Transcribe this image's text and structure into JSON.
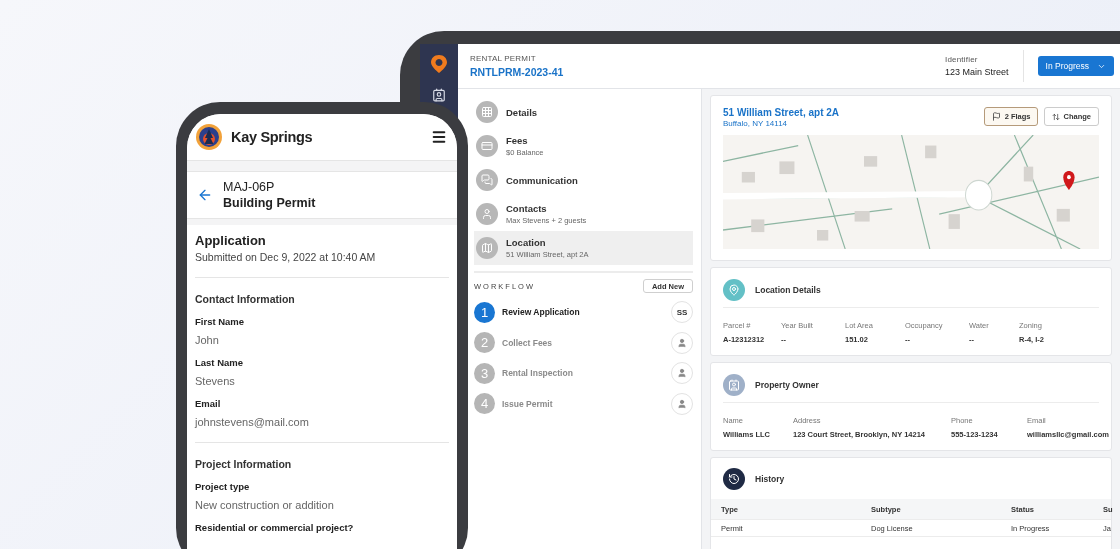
{
  "phone": {
    "brand": "Kay Springs",
    "record": {
      "id": "MAJ-06P",
      "title": "Building Permit"
    },
    "application": {
      "title": "Application",
      "submitted": "Submitted on Dec 9, 2022 at 10:40 AM"
    },
    "sections": [
      {
        "title": "Contact Information",
        "fields": [
          {
            "label": "First Name",
            "value": "John"
          },
          {
            "label": "Last Name",
            "value": "Stevens"
          },
          {
            "label": "Email",
            "value": "johnstevens@mail.com"
          }
        ]
      },
      {
        "title": "Project Information",
        "fields": [
          {
            "label": "Project type",
            "value": "New construction or addition"
          },
          {
            "label": "Residential or commercial project?"
          }
        ]
      }
    ]
  },
  "tablet": {
    "header": {
      "type": "RENTAL PERMIT",
      "number": "RNTLPRM-2023-41",
      "identifier_label": "Identifier",
      "identifier": "123 Main Street",
      "status": "In Progress"
    },
    "nav": [
      {
        "kind": "details",
        "label": "Details",
        "selected": false
      },
      {
        "kind": "fees",
        "label": "Fees",
        "sub": "$0 Balance",
        "selected": false
      },
      {
        "kind": "communication",
        "label": "Communication",
        "selected": false
      },
      {
        "kind": "contacts",
        "label": "Contacts",
        "sub": "Max Stevens + 2 guests",
        "selected": false
      },
      {
        "kind": "location",
        "label": "Location",
        "sub": "51 William Street, apt 2A",
        "selected": true
      }
    ],
    "workflow": {
      "title": "WORKFLOW",
      "add": "Add New",
      "steps": [
        {
          "number": "1",
          "label": "Review Application",
          "active": true,
          "assignee": "SS"
        },
        {
          "number": "2",
          "label": "Collect Fees",
          "active": false
        },
        {
          "number": "3",
          "label": "Rental Inspection",
          "active": false
        },
        {
          "number": "4",
          "label": "Issue Permit",
          "active": false
        }
      ]
    },
    "address": {
      "street": "51 William Street, apt 2A",
      "city": "Buffalo, NY  14114",
      "flags": "2 Flags",
      "change": "Change"
    },
    "location_details": {
      "title": "Location Details",
      "fields": [
        {
          "label": "Parcel #",
          "value": "A-12312312"
        },
        {
          "label": "Year Built",
          "value": "--"
        },
        {
          "label": "Lot Area",
          "value": "151.02"
        },
        {
          "label": "Occupancy",
          "value": "--"
        },
        {
          "label": "Water",
          "value": "--"
        },
        {
          "label": "Zoning",
          "value": "R-4, I-2"
        }
      ]
    },
    "property_owner": {
      "title": "Property Owner",
      "fields": [
        {
          "label": "Name",
          "value": "Williams LLC"
        },
        {
          "label": "Address",
          "value": "123 Court Street, Brooklyn, NY  14214"
        },
        {
          "label": "Phone",
          "value": "555-123-1234"
        },
        {
          "label": "Email",
          "value": "williamsllc@gmail.com"
        }
      ]
    },
    "history": {
      "title": "History",
      "columns": [
        "Type",
        "Subtype",
        "Status",
        "Su"
      ],
      "rows": [
        [
          "Permit",
          "Dog License",
          "In Progress",
          "Ja"
        ]
      ]
    }
  }
}
